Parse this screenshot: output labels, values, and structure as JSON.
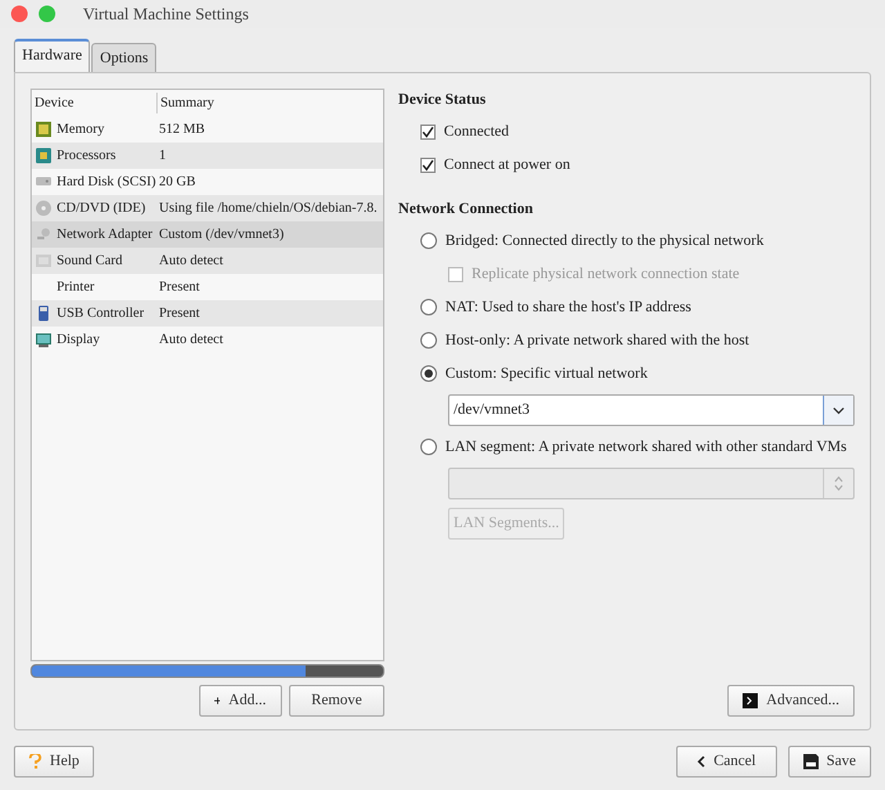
{
  "window": {
    "title": "Virtual Machine Settings"
  },
  "tabs": [
    {
      "label": "Hardware",
      "selected": true
    },
    {
      "label": "Options",
      "selected": false
    }
  ],
  "device_table": {
    "columns": [
      "Device",
      "Summary"
    ],
    "rows": [
      {
        "device": "Memory",
        "summary": "512 MB",
        "selected": false
      },
      {
        "device": "Processors",
        "summary": "1",
        "selected": false
      },
      {
        "device": "Hard Disk (SCSI)",
        "summary": "20 GB",
        "selected": false
      },
      {
        "device": "CD/DVD (IDE)",
        "summary": "Using file /home/chieln/OS/debian-7.8.",
        "selected": false
      },
      {
        "device": "Network Adapter",
        "summary": "Custom (/dev/vmnet3)",
        "selected": true
      },
      {
        "device": "Sound Card",
        "summary": "Auto detect",
        "selected": false
      },
      {
        "device": "Printer",
        "summary": "Present",
        "selected": false
      },
      {
        "device": "USB Controller",
        "summary": "Present",
        "selected": false
      },
      {
        "device": "Display",
        "summary": "Auto detect",
        "selected": false
      }
    ]
  },
  "device_buttons": [
    "Add...",
    "Remove"
  ],
  "device_status": {
    "title": "Device Status",
    "checkboxes": [
      {
        "label": "Connected",
        "checked": true
      },
      {
        "label": "Connect at power on",
        "checked": true
      }
    ]
  },
  "network_connection": {
    "title": "Network Connection",
    "options": [
      {
        "label": "Bridged: Connected directly to the physical network",
        "selected": false,
        "controls": [
          {
            "kind": "checkbox",
            "label": "Replicate physical network connection state",
            "checked": false,
            "disabled": true
          }
        ]
      },
      {
        "label": "NAT: Used to share the host's IP address",
        "selected": false
      },
      {
        "label": "Host-only: A private network shared with the host",
        "selected": false
      },
      {
        "label": "Custom: Specific virtual network",
        "selected": true,
        "controls": [
          {
            "kind": "select",
            "value": "/dev/vmnet3",
            "disabled": false
          }
        ]
      },
      {
        "label": "LAN segment: A private network shared with other standard VMs",
        "selected": false,
        "controls": [
          {
            "kind": "select",
            "disabled": true
          },
          {
            "kind": "button",
            "label": "LAN Segments...",
            "disabled": true
          }
        ]
      }
    ]
  },
  "advanced_button": "Advanced...",
  "footer_buttons": {
    "help": "Help",
    "cancel": "Cancel",
    "save": "Save"
  }
}
